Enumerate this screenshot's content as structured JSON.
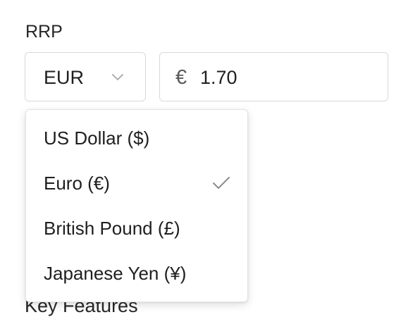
{
  "rrp": {
    "label": "RRP",
    "currency_select": {
      "value": "EUR",
      "icon": "chevron-down-icon"
    },
    "amount_input": {
      "prefix": "€",
      "value": "1.70"
    }
  },
  "dropdown": {
    "options": [
      {
        "label": "US Dollar ($)",
        "selected": false
      },
      {
        "label": "Euro (€)",
        "selected": true
      },
      {
        "label": "British Pound (£)",
        "selected": false
      },
      {
        "label": "Japanese Yen (¥)",
        "selected": false
      }
    ],
    "selected_icon": "check-icon"
  },
  "below": {
    "label": "Key Features"
  },
  "colors": {
    "border": "#d9d9d9",
    "text": "#1f1f1f",
    "icon": "#8c8c8c"
  }
}
